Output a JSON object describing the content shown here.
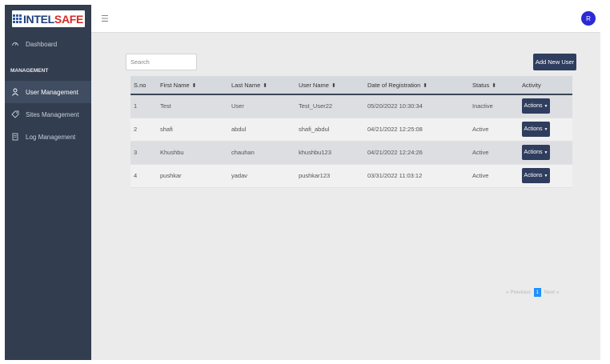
{
  "brand": {
    "logo_prefix": "INTEL",
    "logo_suffix": "SAFE"
  },
  "sidebar": {
    "dashboard_label": "Dashboard",
    "section_label": "MANAGEMENT",
    "items": [
      {
        "label": "User Management",
        "icon": "user-icon",
        "active": true
      },
      {
        "label": "Sites Management",
        "icon": "tag-icon",
        "active": false
      },
      {
        "label": "Log Management",
        "icon": "document-icon",
        "active": false
      }
    ]
  },
  "header": {
    "menu_icon": "hamburger-icon",
    "avatar_initial": "R",
    "avatar_color": "#2a2ad6"
  },
  "toolbar": {
    "search_placeholder": "Search",
    "search_value": "",
    "add_user_label": "Add New User"
  },
  "table": {
    "columns": [
      "S.no",
      "First Name",
      "Last Name",
      "User Name",
      "Date of Registration",
      "Status",
      "Activity"
    ],
    "rows": [
      {
        "sno": "1",
        "first": "Test",
        "last": "User",
        "username": "Test_User22",
        "date": "05/20/2022 10:30:34",
        "status": "Inactive",
        "action": "Actions"
      },
      {
        "sno": "2",
        "first": "shafi",
        "last": "abdul",
        "username": "shafi_abdul",
        "date": "04/21/2022 12:25:08",
        "status": "Active",
        "action": "Actions"
      },
      {
        "sno": "3",
        "first": "Khushbu",
        "last": "chauhan",
        "username": "khushbu123",
        "date": "04/21/2022 12:24:26",
        "status": "Active",
        "action": "Actions"
      },
      {
        "sno": "4",
        "first": "pushkar",
        "last": "yadav",
        "username": "pushkar123",
        "date": "03/31/2022 11:03:12",
        "status": "Active",
        "action": "Actions"
      }
    ]
  },
  "pagination": {
    "prev": "« Previous",
    "current": "1",
    "next": "Next »"
  },
  "colors": {
    "sidebar_bg": "#323d4f",
    "primary_button": "#2f3d5e",
    "page_active": "#1e90ff"
  }
}
